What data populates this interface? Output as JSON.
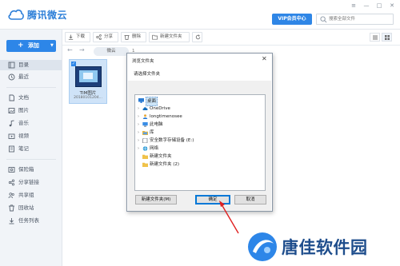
{
  "app": {
    "title": "腾讯微云",
    "vip_label": "VIP会员中心",
    "search_placeholder": "搜索全部文件",
    "window_controls": {
      "menu": "≡",
      "minimize": "—",
      "maximize": "□",
      "close": "✕"
    }
  },
  "sidebar": {
    "add_label": "添加",
    "items": [
      {
        "label": "目录",
        "icon": "directory-icon",
        "active": true
      },
      {
        "label": "最近",
        "icon": "clock-icon"
      },
      {
        "label": "文档",
        "icon": "document-icon"
      },
      {
        "label": "图片",
        "icon": "image-icon"
      },
      {
        "label": "音乐",
        "icon": "music-icon"
      },
      {
        "label": "视频",
        "icon": "video-icon"
      },
      {
        "label": "笔记",
        "icon": "note-icon"
      },
      {
        "label": "保险箱",
        "icon": "safe-icon"
      },
      {
        "label": "分享链接",
        "icon": "share-link-icon"
      },
      {
        "label": "共享组",
        "icon": "group-icon"
      },
      {
        "label": "回收站",
        "icon": "trash-icon"
      },
      {
        "label": "任务列表",
        "icon": "task-list-icon"
      }
    ]
  },
  "toolbar": {
    "download": "下载",
    "share": "分享",
    "delete": "删除",
    "new_folder": "新建文件夹"
  },
  "breadcrumb": {
    "current": "微云",
    "count": "1"
  },
  "file": {
    "name": "TIM图片",
    "subtitle": "20180101204..."
  },
  "dialog": {
    "title": "浏览文件夹",
    "close": "✕",
    "prompt": "请选择文件夹",
    "tree": [
      {
        "label": "桌面",
        "icon": "desktop-icon",
        "expandable": false,
        "selected": true
      },
      {
        "label": "OneDrive",
        "icon": "onedrive-icon",
        "expandable": true
      },
      {
        "label": "longtimenosee",
        "icon": "user-icon",
        "expandable": true
      },
      {
        "label": "此电脑",
        "icon": "computer-icon",
        "expandable": true
      },
      {
        "label": "库",
        "icon": "library-icon",
        "expandable": true
      },
      {
        "label": "安全数字存储设备 (E:)",
        "icon": "sd-card-icon",
        "expandable": true
      },
      {
        "label": "网络",
        "icon": "network-icon",
        "expandable": true
      },
      {
        "label": "新建文件夹",
        "icon": "folder-icon",
        "expandable": false
      },
      {
        "label": "新建文件夹 (2)",
        "icon": "folder-icon",
        "expandable": false
      }
    ],
    "new_folder_button": "新建文件夹(M)",
    "ok_button": "确定",
    "cancel_button": "取消"
  },
  "watermark": {
    "text": "唐佳软件园"
  },
  "colors": {
    "brand_blue": "#2d86e8",
    "annotation_red": "#e02020",
    "watermark_blue": "#1e4d8c"
  }
}
